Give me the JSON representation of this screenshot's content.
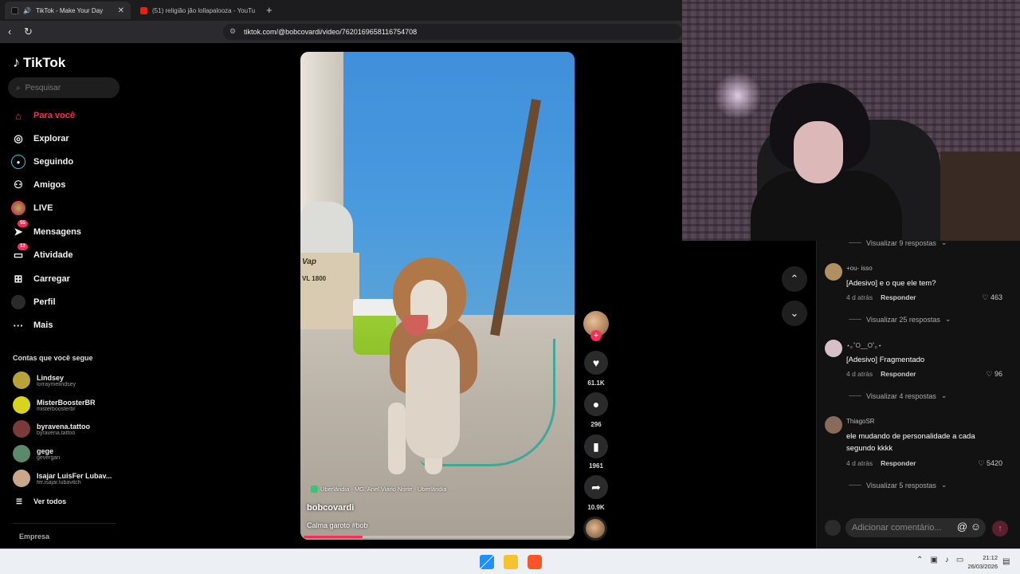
{
  "browser": {
    "tabs": [
      {
        "title": "TikTok - Make Your Day",
        "active": true
      },
      {
        "title": "(51) religião jão lollapalooza - YouTu",
        "active": false
      }
    ],
    "url": "tiktok.com/@bobcovardi/video/7620169658116754708"
  },
  "sidebar": {
    "logo": "TikTok",
    "search_placeholder": "Pesquisar",
    "menu": [
      {
        "label": "Para você",
        "icon": "home-icon",
        "active": true
      },
      {
        "label": "Explorar",
        "icon": "compass-icon"
      },
      {
        "label": "Seguindo",
        "icon": "following-icon"
      },
      {
        "label": "Amigos",
        "icon": "friends-icon"
      },
      {
        "label": "LIVE",
        "icon": "live-icon"
      },
      {
        "label": "Mensagens",
        "icon": "messages-icon",
        "badge": "55"
      },
      {
        "label": "Atividade",
        "icon": "activity-icon",
        "badge": "12"
      },
      {
        "label": "Carregar",
        "icon": "upload-icon"
      },
      {
        "label": "Perfil",
        "icon": "profile-icon"
      },
      {
        "label": "Mais",
        "icon": "more-icon"
      }
    ],
    "following_title": "Contas que você segue",
    "following": [
      {
        "name": "Lindsey",
        "handle": "lorraymelindsey",
        "color": "#b8a23a"
      },
      {
        "name": "MisterBoosterBR",
        "handle": "misterboosterbr",
        "color": "#d6d41e"
      },
      {
        "name": "byravena.tattoo",
        "handle": "byravena.tattoo",
        "color": "#7a3a3a"
      },
      {
        "name": "gege",
        "handle": "gevergari",
        "color": "#5a8a6a"
      },
      {
        "name": "Isajar LuisFer Lubav...",
        "handle": "fer.isajar.lubavitch",
        "color": "#c9a88a"
      }
    ],
    "see_all": "Ver todos",
    "company": "Empresa"
  },
  "video": {
    "location": "Uberlândia - MG, Anel Viário Norte - Uberlândia",
    "username": "bobcovardi",
    "caption": "Calma garoto #bob",
    "progress": 0.22,
    "box_text_1": "Vap",
    "box_text_2": "VL 1800"
  },
  "actions": {
    "likes": "61.1K",
    "comments": "296",
    "saves": "1961",
    "shares": "10.9K"
  },
  "comments": {
    "top_view_replies": "Visualizar 9 respostas",
    "items": [
      {
        "user": "+ou- isso",
        "text": "[Adesivo] e o que ele tem?",
        "time": "4 d atrás",
        "reply": "Responder",
        "likes": "463",
        "view_replies": "Visualizar 25 respostas",
        "color": "#b09060"
      },
      {
        "user": "⋆｡˚O__O˚｡⋆",
        "text": "[Adesivo] Fragmentado",
        "time": "4 d atrás",
        "reply": "Responder",
        "likes": "96",
        "view_replies": "Visualizar 4 respostas",
        "color": "#d8c0c8"
      },
      {
        "user": "ThiagoSR",
        "text": "ele mudando de personalidade a cada segundo kkkk",
        "time": "4 d atrás",
        "reply": "Responder",
        "likes": "5420",
        "view_replies": "Visualizar 5 respostas",
        "color": "#8a6a5a"
      }
    ],
    "input_placeholder": "Adicionar comentário..."
  },
  "taskbar": {
    "time": "21:12",
    "date": "26/03/2026"
  }
}
